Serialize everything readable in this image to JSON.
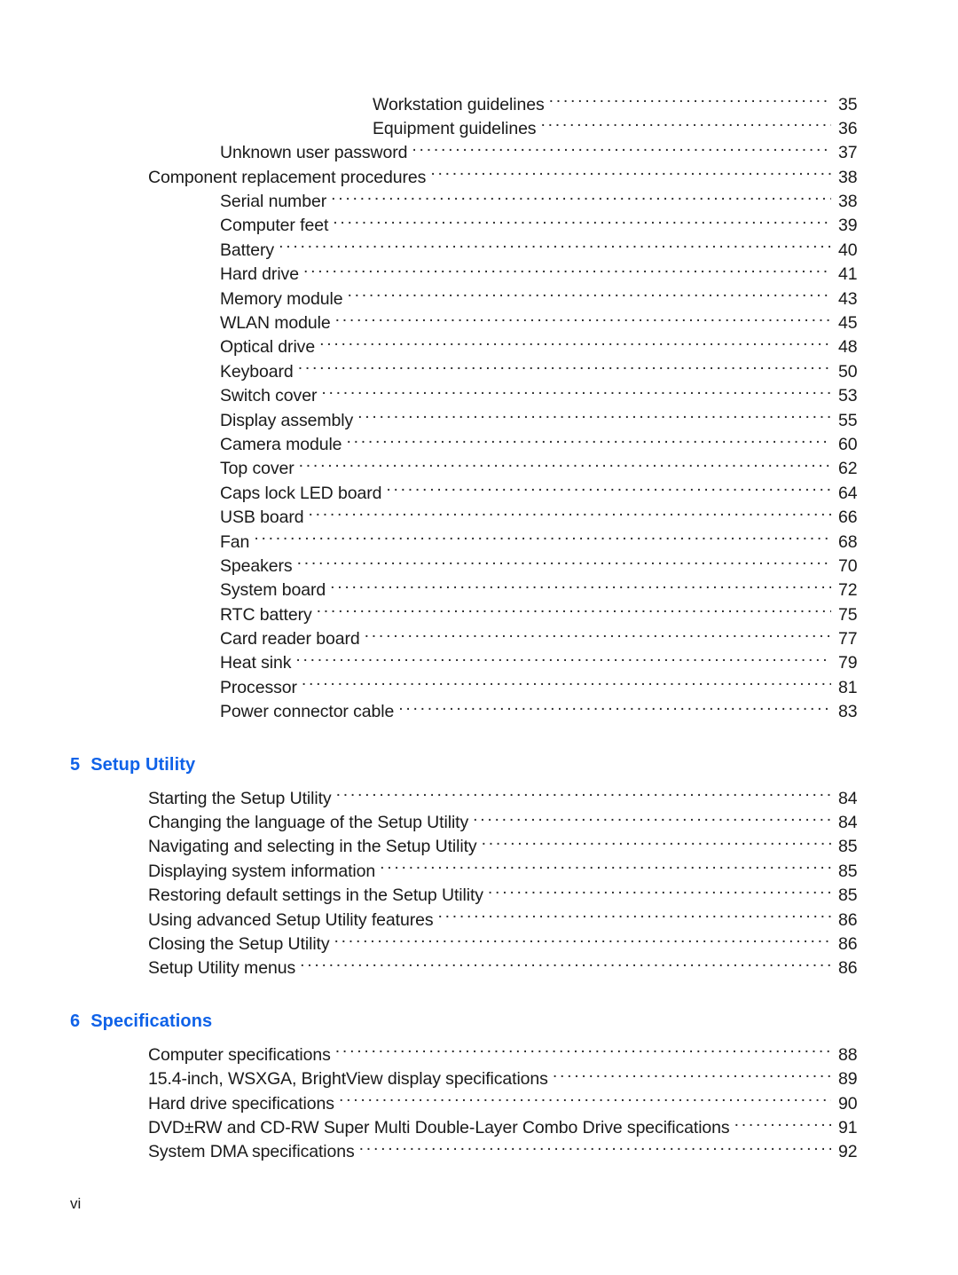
{
  "document": {
    "type": "table-of-contents",
    "page_label": "vi",
    "accent_color": "#0f62e8",
    "text_color": "#1a1a1a",
    "background_color": "#ffffff"
  },
  "toc": {
    "blocks": [
      {
        "kind": "entries",
        "entries": [
          {
            "title": "Workstation guidelines",
            "page": "35",
            "level": 3
          },
          {
            "title": "Equipment guidelines",
            "page": "36",
            "level": 3
          },
          {
            "title": "Unknown user password",
            "page": "37",
            "level": 2
          },
          {
            "title": "Component replacement procedures",
            "page": "38",
            "level": 1
          },
          {
            "title": "Serial number",
            "page": "38",
            "level": 2
          },
          {
            "title": "Computer feet",
            "page": "39",
            "level": 2
          },
          {
            "title": "Battery",
            "page": "40",
            "level": 2
          },
          {
            "title": "Hard drive",
            "page": "41",
            "level": 2
          },
          {
            "title": "Memory module",
            "page": "43",
            "level": 2
          },
          {
            "title": "WLAN module",
            "page": "45",
            "level": 2
          },
          {
            "title": "Optical drive",
            "page": "48",
            "level": 2
          },
          {
            "title": "Keyboard",
            "page": "50",
            "level": 2
          },
          {
            "title": "Switch cover",
            "page": "53",
            "level": 2
          },
          {
            "title": "Display assembly",
            "page": "55",
            "level": 2
          },
          {
            "title": "Camera module",
            "page": "60",
            "level": 2
          },
          {
            "title": "Top cover",
            "page": "62",
            "level": 2
          },
          {
            "title": "Caps lock LED board",
            "page": "64",
            "level": 2
          },
          {
            "title": "USB board",
            "page": "66",
            "level": 2
          },
          {
            "title": "Fan",
            "page": "68",
            "level": 2
          },
          {
            "title": "Speakers",
            "page": "70",
            "level": 2
          },
          {
            "title": "System board",
            "page": "72",
            "level": 2
          },
          {
            "title": "RTC battery",
            "page": "75",
            "level": 2
          },
          {
            "title": "Card reader board",
            "page": "77",
            "level": 2
          },
          {
            "title": "Heat sink",
            "page": "79",
            "level": 2
          },
          {
            "title": "Processor",
            "page": "81",
            "level": 2
          },
          {
            "title": "Power connector cable",
            "page": "83",
            "level": 2
          }
        ]
      },
      {
        "kind": "chapter",
        "number": "5",
        "title": "Setup Utility",
        "entries": [
          {
            "title": "Starting the Setup Utility",
            "page": "84",
            "level": 1
          },
          {
            "title": "Changing the language of the Setup Utility",
            "page": "84",
            "level": 1
          },
          {
            "title": "Navigating and selecting in the Setup Utility",
            "page": "85",
            "level": 1
          },
          {
            "title": "Displaying system information",
            "page": "85",
            "level": 1
          },
          {
            "title": "Restoring default settings in the Setup Utility",
            "page": "85",
            "level": 1
          },
          {
            "title": "Using advanced Setup Utility features",
            "page": "86",
            "level": 1
          },
          {
            "title": "Closing the Setup Utility",
            "page": "86",
            "level": 1
          },
          {
            "title": "Setup Utility menus",
            "page": "86",
            "level": 1
          }
        ]
      },
      {
        "kind": "chapter",
        "number": "6",
        "title": "Specifications",
        "entries": [
          {
            "title": "Computer specifications",
            "page": "88",
            "level": 1
          },
          {
            "title": "15.4-inch, WSXGA, BrightView display specifications",
            "page": "89",
            "level": 1
          },
          {
            "title": "Hard drive specifications",
            "page": "90",
            "level": 1
          },
          {
            "title": "DVD±RW and CD-RW Super Multi Double-Layer Combo Drive specifications",
            "page": "91",
            "level": 1
          },
          {
            "title": "System DMA specifications",
            "page": "92",
            "level": 1
          }
        ]
      }
    ]
  }
}
